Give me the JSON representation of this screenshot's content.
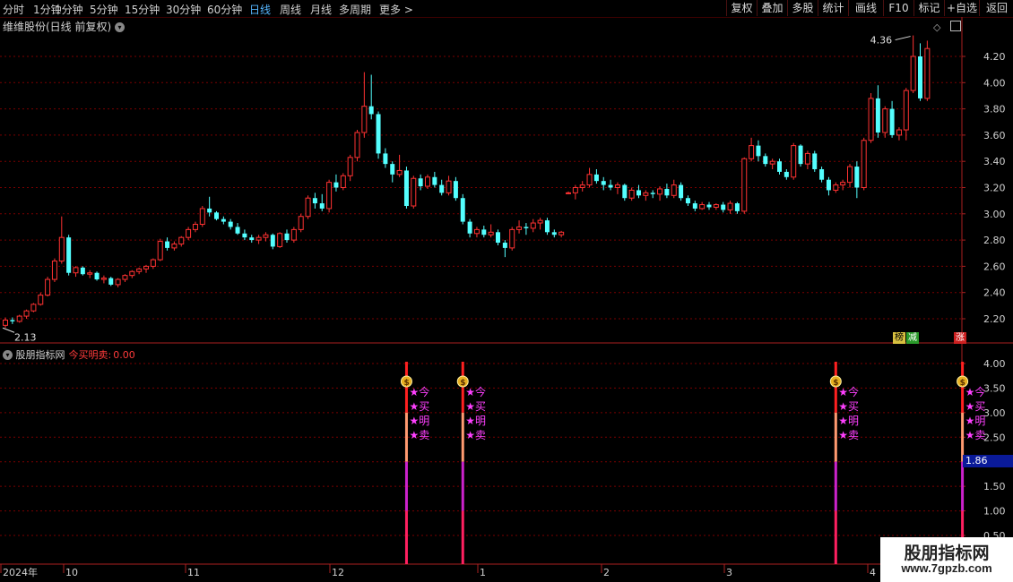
{
  "toolbar": {
    "timeframes": [
      "分时",
      "1分钟",
      "5分钟",
      "15分钟",
      "30分钟",
      "60分钟",
      "日线",
      "周线",
      "月线",
      "多周期",
      "更多 >"
    ],
    "active": "日线",
    "right_buttons": [
      "复权",
      "叠加",
      "多股",
      "统计",
      "画线",
      "F10",
      "+自选",
      "返回"
    ]
  },
  "stock": {
    "title": "维维股份(日线 前复权)",
    "high_label": "4.36",
    "low_label": "2.13"
  },
  "flags": {
    "a": "榜",
    "b": "减",
    "c": "涨"
  },
  "indicator": {
    "name": "股朋指标网",
    "label": "今买明卖:",
    "value": "0.00",
    "signal_chars": [
      "今",
      "买",
      "明",
      "卖"
    ],
    "current_box": "1.86",
    "coin_symbol": "$"
  },
  "colors": {
    "up": "#ff3232",
    "down": "#54ffff",
    "grid": "#7a0000",
    "axis": "#aa2020"
  },
  "price_axis": [
    "4.20",
    "4.00",
    "3.80",
    "3.60",
    "3.40",
    "3.20",
    "3.00",
    "2.80",
    "2.60",
    "2.40",
    "2.20"
  ],
  "ind_axis": [
    "4.00",
    "3.50",
    "3.00",
    "2.50",
    "2.00",
    "1.50",
    "1.00",
    "0.50"
  ],
  "date_axis": [
    "2024年",
    "10",
    "11",
    "12",
    "1",
    "2",
    "3",
    "4"
  ],
  "watermark": {
    "line1": "股朋指标网",
    "line2": "www.7gpzb.com"
  },
  "chart_data": {
    "type": "candlestick",
    "title": "维维股份(日线 前复权)",
    "ylim": [
      2.13,
      4.36
    ],
    "ohlc": [
      [
        2.15,
        2.21,
        2.13,
        2.19
      ],
      [
        2.19,
        2.21,
        2.16,
        2.18
      ],
      [
        2.18,
        2.23,
        2.17,
        2.22
      ],
      [
        2.22,
        2.27,
        2.2,
        2.26
      ],
      [
        2.26,
        2.32,
        2.25,
        2.31
      ],
      [
        2.31,
        2.4,
        2.3,
        2.38
      ],
      [
        2.38,
        2.52,
        2.37,
        2.5
      ],
      [
        2.5,
        2.66,
        2.48,
        2.64
      ],
      [
        2.64,
        2.98,
        2.62,
        2.82
      ],
      [
        2.82,
        2.84,
        2.53,
        2.55
      ],
      [
        2.55,
        2.6,
        2.52,
        2.59
      ],
      [
        2.59,
        2.6,
        2.53,
        2.54
      ],
      [
        2.54,
        2.57,
        2.51,
        2.55
      ],
      [
        2.55,
        2.56,
        2.49,
        2.5
      ],
      [
        2.5,
        2.53,
        2.47,
        2.51
      ],
      [
        2.51,
        2.52,
        2.45,
        2.46
      ],
      [
        2.46,
        2.51,
        2.44,
        2.5
      ],
      [
        2.5,
        2.54,
        2.48,
        2.53
      ],
      [
        2.53,
        2.57,
        2.51,
        2.56
      ],
      [
        2.56,
        2.59,
        2.54,
        2.58
      ],
      [
        2.58,
        2.61,
        2.55,
        2.6
      ],
      [
        2.6,
        2.66,
        2.58,
        2.65
      ],
      [
        2.65,
        2.81,
        2.64,
        2.79
      ],
      [
        2.79,
        2.82,
        2.72,
        2.74
      ],
      [
        2.74,
        2.79,
        2.72,
        2.77
      ],
      [
        2.77,
        2.83,
        2.75,
        2.82
      ],
      [
        2.82,
        2.9,
        2.8,
        2.88
      ],
      [
        2.88,
        2.94,
        2.86,
        2.92
      ],
      [
        2.92,
        3.06,
        2.9,
        3.04
      ],
      [
        3.04,
        3.13,
        2.98,
        3.01
      ],
      [
        3.01,
        3.02,
        2.95,
        2.96
      ],
      [
        2.96,
        2.98,
        2.92,
        2.94
      ],
      [
        2.94,
        2.96,
        2.88,
        2.9
      ],
      [
        2.9,
        2.93,
        2.84,
        2.85
      ],
      [
        2.85,
        2.88,
        2.8,
        2.82
      ],
      [
        2.82,
        2.84,
        2.78,
        2.8
      ],
      [
        2.8,
        2.84,
        2.77,
        2.82
      ],
      [
        2.82,
        2.86,
        2.79,
        2.84
      ],
      [
        2.84,
        2.85,
        2.73,
        2.75
      ],
      [
        2.75,
        2.86,
        2.74,
        2.85
      ],
      [
        2.85,
        2.88,
        2.78,
        2.8
      ],
      [
        2.8,
        2.9,
        2.78,
        2.88
      ],
      [
        2.88,
        3.0,
        2.86,
        2.98
      ],
      [
        2.98,
        3.14,
        2.96,
        3.12
      ],
      [
        3.12,
        3.16,
        3.04,
        3.08
      ],
      [
        3.08,
        3.15,
        3.02,
        3.04
      ],
      [
        3.04,
        3.26,
        3.01,
        3.24
      ],
      [
        3.24,
        3.3,
        3.17,
        3.2
      ],
      [
        3.2,
        3.31,
        3.18,
        3.29
      ],
      [
        3.29,
        3.45,
        3.25,
        3.43
      ],
      [
        3.43,
        3.64,
        3.4,
        3.62
      ],
      [
        3.62,
        4.08,
        3.58,
        3.82
      ],
      [
        3.82,
        4.06,
        3.72,
        3.76
      ],
      [
        3.76,
        3.78,
        3.42,
        3.46
      ],
      [
        3.46,
        3.5,
        3.35,
        3.38
      ],
      [
        3.38,
        3.4,
        3.24,
        3.3
      ],
      [
        3.3,
        3.45,
        3.28,
        3.33
      ],
      [
        3.33,
        3.36,
        3.04,
        3.06
      ],
      [
        3.06,
        3.29,
        3.04,
        3.27
      ],
      [
        3.27,
        3.3,
        3.18,
        3.21
      ],
      [
        3.21,
        3.3,
        3.19,
        3.28
      ],
      [
        3.28,
        3.32,
        3.2,
        3.22
      ],
      [
        3.22,
        3.26,
        3.14,
        3.16
      ],
      [
        3.16,
        3.29,
        3.14,
        3.25
      ],
      [
        3.25,
        3.28,
        3.1,
        3.12
      ],
      [
        3.12,
        3.15,
        2.92,
        2.94
      ],
      [
        2.94,
        2.96,
        2.82,
        2.85
      ],
      [
        2.85,
        2.9,
        2.82,
        2.88
      ],
      [
        2.88,
        2.91,
        2.82,
        2.84
      ],
      [
        2.84,
        2.92,
        2.82,
        2.86
      ],
      [
        2.86,
        2.88,
        2.76,
        2.78
      ],
      [
        2.78,
        2.8,
        2.67,
        2.74
      ],
      [
        2.74,
        2.9,
        2.72,
        2.88
      ],
      [
        2.88,
        2.95,
        2.85,
        2.9
      ],
      [
        2.9,
        2.93,
        2.84,
        2.89
      ],
      [
        2.89,
        2.96,
        2.86,
        2.93
      ],
      [
        2.93,
        2.97,
        2.88,
        2.95
      ],
      [
        2.95,
        2.97,
        2.84,
        2.86
      ],
      [
        2.86,
        2.88,
        2.82,
        2.84
      ],
      [
        2.84,
        2.87,
        2.82,
        2.86
      ],
      [
        3.16,
        3.17,
        3.15,
        3.16
      ],
      [
        3.16,
        3.22,
        3.11,
        3.2
      ],
      [
        3.2,
        3.25,
        3.17,
        3.22
      ],
      [
        3.22,
        3.35,
        3.2,
        3.3
      ],
      [
        3.3,
        3.34,
        3.23,
        3.25
      ],
      [
        3.25,
        3.28,
        3.18,
        3.22
      ],
      [
        3.22,
        3.26,
        3.18,
        3.2
      ],
      [
        3.2,
        3.24,
        3.15,
        3.22
      ],
      [
        3.22,
        3.23,
        3.1,
        3.12
      ],
      [
        3.12,
        3.2,
        3.1,
        3.18
      ],
      [
        3.18,
        3.22,
        3.12,
        3.14
      ],
      [
        3.14,
        3.18,
        3.1,
        3.16
      ],
      [
        3.16,
        3.18,
        3.12,
        3.15
      ],
      [
        3.15,
        3.21,
        3.1,
        3.19
      ],
      [
        3.19,
        3.23,
        3.12,
        3.14
      ],
      [
        3.14,
        3.26,
        3.12,
        3.22
      ],
      [
        3.22,
        3.24,
        3.1,
        3.12
      ],
      [
        3.12,
        3.14,
        3.06,
        3.08
      ],
      [
        3.08,
        3.1,
        3.02,
        3.04
      ],
      [
        3.04,
        3.09,
        3.03,
        3.07
      ],
      [
        3.07,
        3.09,
        3.03,
        3.05
      ],
      [
        3.05,
        3.08,
        3.03,
        3.07
      ],
      [
        3.07,
        3.09,
        3.01,
        3.03
      ],
      [
        3.03,
        3.1,
        3.0,
        3.08
      ],
      [
        3.08,
        3.09,
        3.0,
        3.02
      ],
      [
        3.02,
        3.43,
        3.0,
        3.42
      ],
      [
        3.42,
        3.58,
        3.4,
        3.52
      ],
      [
        3.52,
        3.56,
        3.4,
        3.44
      ],
      [
        3.44,
        3.46,
        3.36,
        3.38
      ],
      [
        3.38,
        3.42,
        3.34,
        3.4
      ],
      [
        3.4,
        3.42,
        3.3,
        3.32
      ],
      [
        3.32,
        3.34,
        3.26,
        3.28
      ],
      [
        3.28,
        3.54,
        3.26,
        3.52
      ],
      [
        3.52,
        3.53,
        3.36,
        3.38
      ],
      [
        3.38,
        3.48,
        3.34,
        3.46
      ],
      [
        3.46,
        3.48,
        3.32,
        3.34
      ],
      [
        3.34,
        3.36,
        3.24,
        3.26
      ],
      [
        3.26,
        3.28,
        3.14,
        3.18
      ],
      [
        3.18,
        3.24,
        3.16,
        3.22
      ],
      [
        3.22,
        3.26,
        3.18,
        3.24
      ],
      [
        3.24,
        3.38,
        3.2,
        3.36
      ],
      [
        3.36,
        3.4,
        3.12,
        3.2
      ],
      [
        3.2,
        3.58,
        3.18,
        3.56
      ],
      [
        3.56,
        3.92,
        3.54,
        3.88
      ],
      [
        3.88,
        3.98,
        3.58,
        3.62
      ],
      [
        3.62,
        3.82,
        3.58,
        3.8
      ],
      [
        3.8,
        3.86,
        3.58,
        3.6
      ],
      [
        3.6,
        3.66,
        3.56,
        3.64
      ],
      [
        3.64,
        3.96,
        3.56,
        3.94
      ],
      [
        3.94,
        4.36,
        3.92,
        4.2
      ],
      [
        4.2,
        4.3,
        3.86,
        3.88
      ],
      [
        3.88,
        4.32,
        3.86,
        4.26
      ]
    ],
    "signals": [
      {
        "bar": 57,
        "value": 4.0
      },
      {
        "bar": 65,
        "value": 4.0
      },
      {
        "bar": 118,
        "value": 4.0
      },
      {
        "bar": 136,
        "value": 4.0
      }
    ]
  }
}
